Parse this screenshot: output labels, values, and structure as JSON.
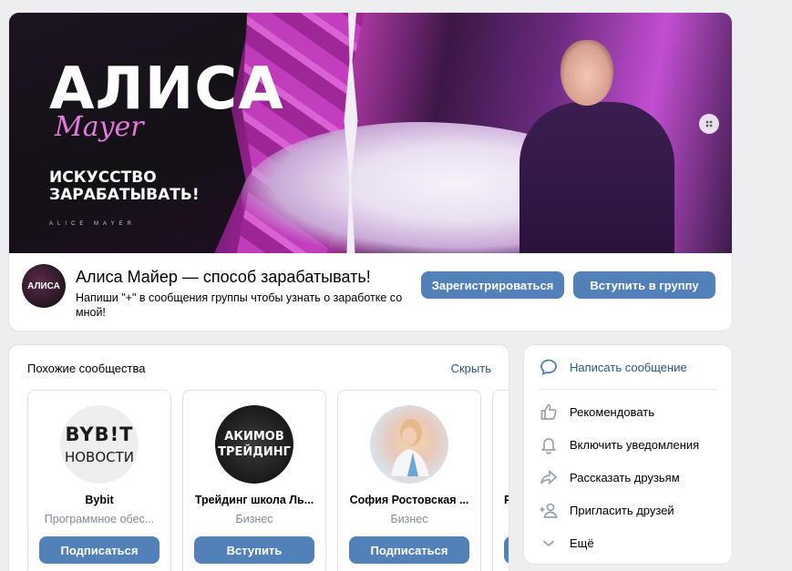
{
  "cover": {
    "title": "АЛИСА",
    "script": "Mayer",
    "tagline": "ИСКУССТВО ЗАРАБАТЫВАТЬ!",
    "signature": "ALICE MAYER",
    "menu_icon": "dots-icon"
  },
  "group": {
    "avatar_text": "АЛИСА",
    "title": "Алиса Майер — способ зарабатывать!",
    "status": "Напиши \"+\" в сообщения группы чтобы узнать о заработке со мной!",
    "register_label": "Зарегистрироваться",
    "join_label": "Вступить в группу"
  },
  "similar": {
    "title": "Похожие сообщества",
    "hide_label": "Скрыть",
    "items": [
      {
        "name": "Bybit",
        "type": "Программное обес...",
        "button": "Подписаться",
        "avatar_line1": "BYB!T",
        "avatar_line2": "НОВОСТИ"
      },
      {
        "name": "Трейдинг школа Ль...",
        "type": "Бизнес",
        "button": "Вступить",
        "avatar_line1": "АКИМОВ",
        "avatar_line2": "ТРЕЙДИНГ"
      },
      {
        "name": "София Ростовская ...",
        "type": "Бизнес",
        "button": "Подписаться",
        "avatar_line1": "",
        "avatar_line2": ""
      },
      {
        "name": "Р",
        "type": "",
        "button": "",
        "avatar_line1": "",
        "avatar_line2": ""
      }
    ]
  },
  "actions": {
    "items": [
      {
        "label": "Написать сообщение",
        "icon": "message-icon"
      },
      {
        "label": "Рекомендовать",
        "icon": "thumbs-up-icon"
      },
      {
        "label": "Включить уведомления",
        "icon": "bell-icon"
      },
      {
        "label": "Рассказать друзьям",
        "icon": "share-icon"
      },
      {
        "label": "Пригласить друзей",
        "icon": "add-user-icon"
      },
      {
        "label": "Ещё",
        "icon": "chevron-down-icon"
      }
    ]
  },
  "colors": {
    "accent": "#5181b8",
    "link": "#2a5885",
    "muted": "#818c99",
    "icon": "#99a2ad",
    "background": "#edeef0"
  }
}
